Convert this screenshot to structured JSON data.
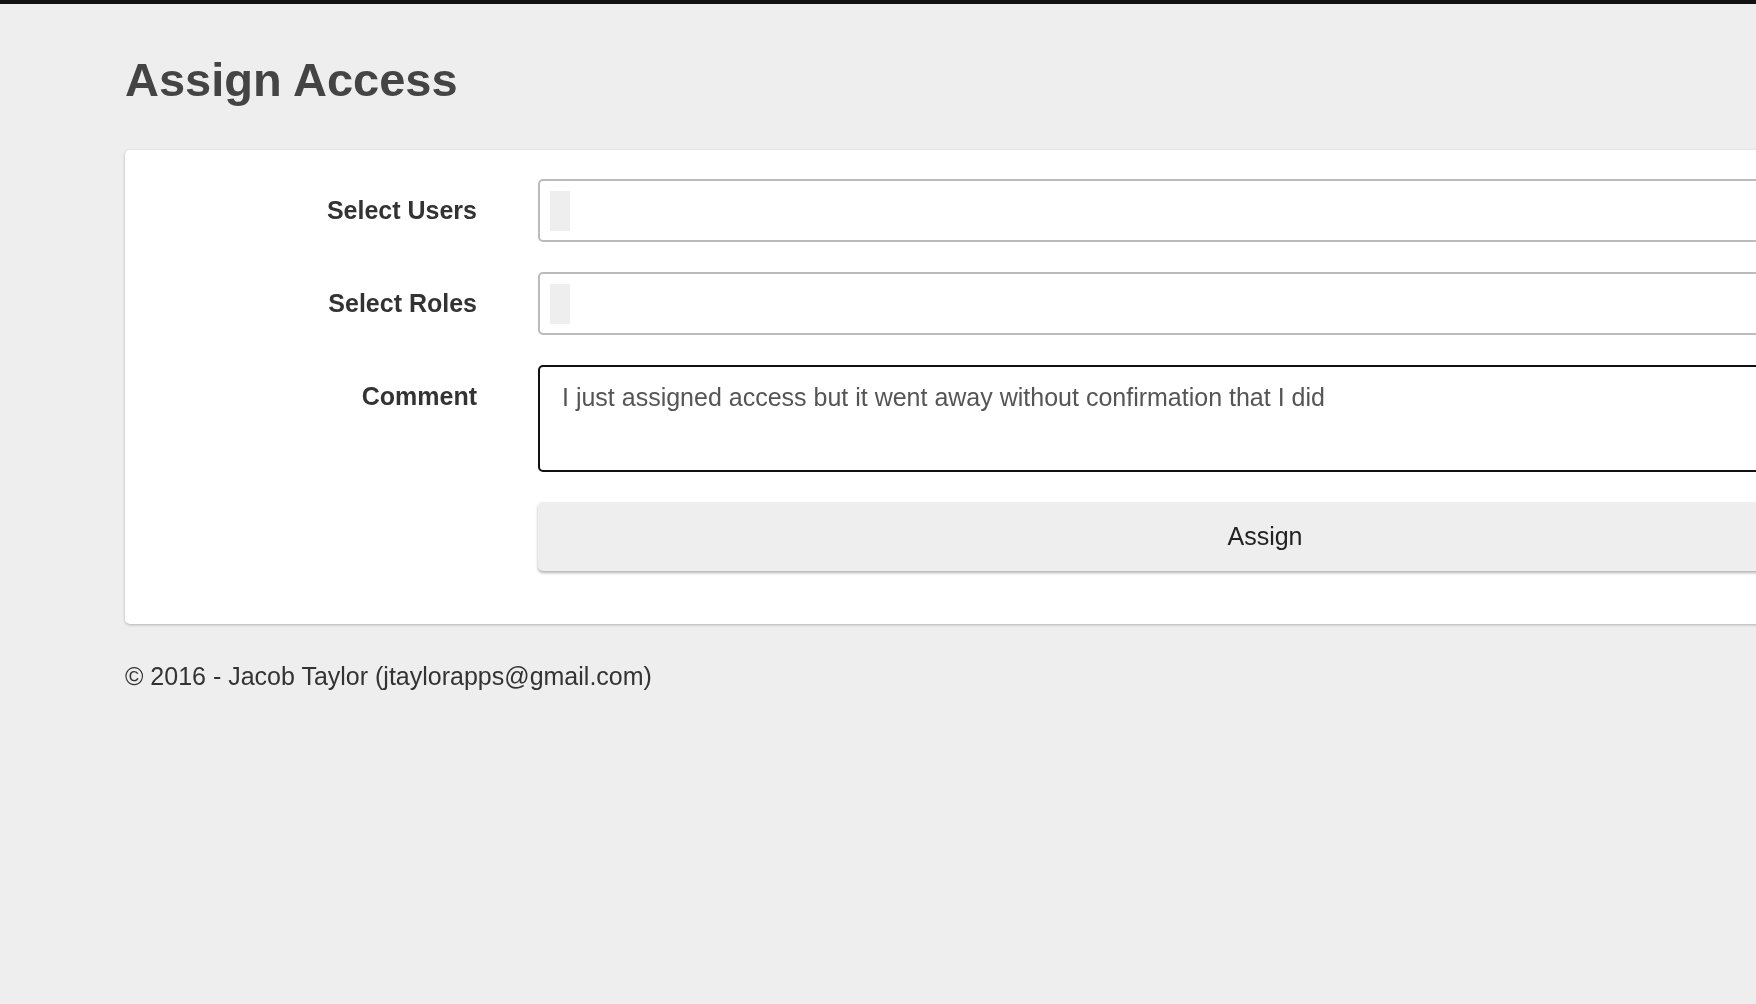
{
  "page": {
    "title": "Assign Access"
  },
  "form": {
    "fields": [
      {
        "kind": "select",
        "label": "Select Users",
        "focused": false
      },
      {
        "kind": "select",
        "label": "Select Roles",
        "focused": false
      },
      {
        "kind": "textarea",
        "label": "Comment",
        "value": "I just assigned access but it went away without confirmation that I did",
        "focused": true
      }
    ],
    "submit": "Assign"
  },
  "footer": "© 2016 - Jacob Taylor (jtaylorapps@gmail.com)"
}
